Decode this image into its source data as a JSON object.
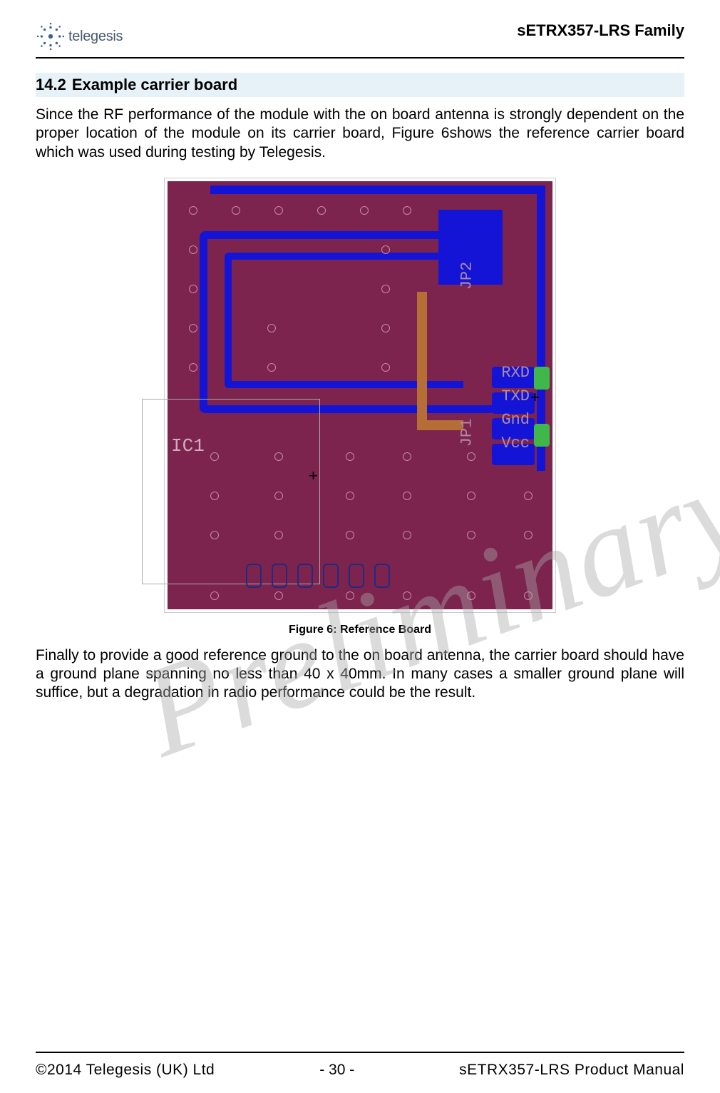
{
  "header": {
    "logo_text": "telegesis",
    "product_family": "sETRX357-LRS Family"
  },
  "section": {
    "number": "14.2",
    "title": "Example carrier board"
  },
  "paragraphs": {
    "p1": "Since the RF performance of the module with the on board antenna is strongly dependent on the proper location of the module on its carrier board, Figure 6shows the reference carrier board which was used during testing by Telegesis.",
    "p2": "Finally to provide a good reference ground to the on board antenna, the carrier board should have a ground plane spanning no less than 40 x 40mm. In many cases a smaller ground plane will suffice, but a degradation in radio performance could be the result."
  },
  "figure": {
    "caption": "Figure 6:  Reference Board",
    "labels": {
      "ic": "IC1",
      "jp2": "JP2",
      "jp1": "JP1",
      "pin1": "RXD",
      "pin2": "TXD",
      "pin3": "Gnd",
      "pin4": "Vcc"
    }
  },
  "watermark": "Preliminary",
  "footer": {
    "left": "©2014 Telegesis (UK) Ltd",
    "center": "- 30 -",
    "right": "sETRX357-LRS Product Manual"
  }
}
